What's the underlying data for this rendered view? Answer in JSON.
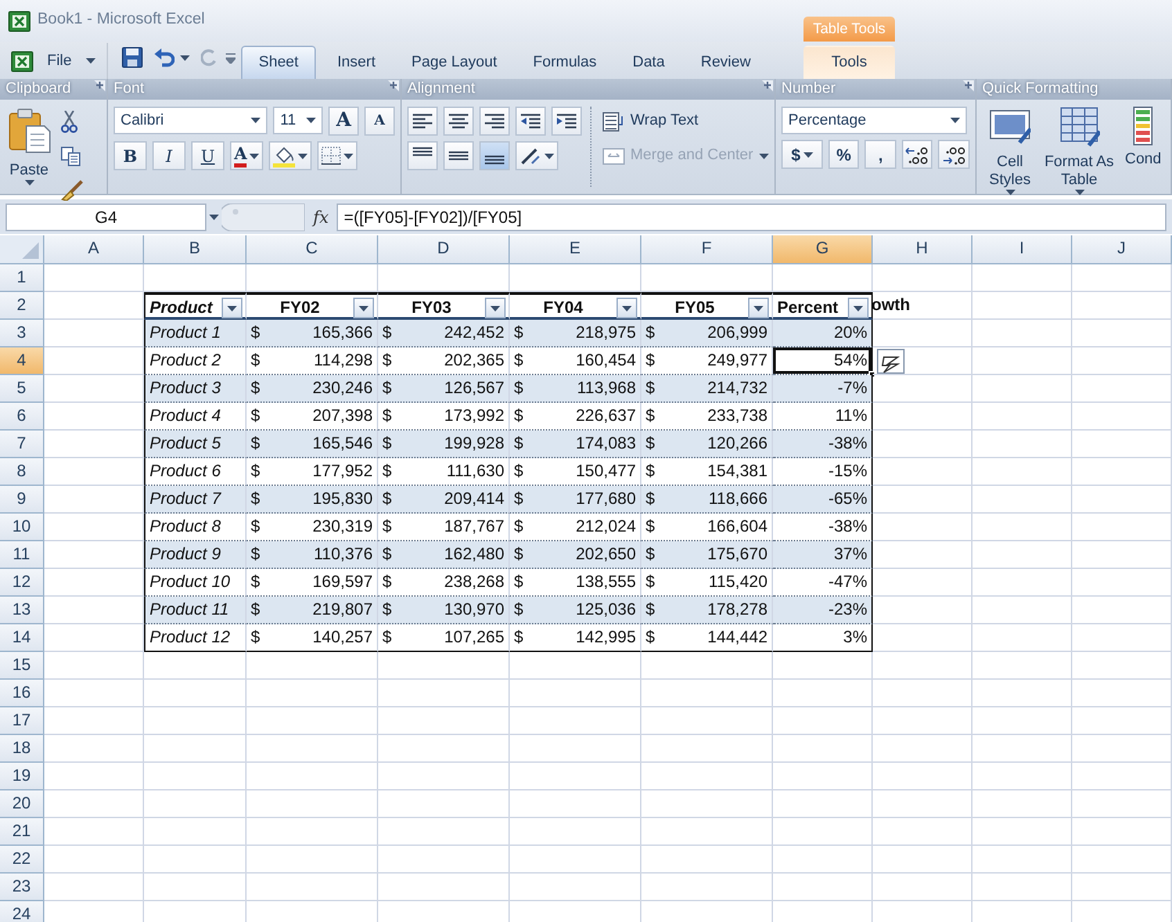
{
  "window": {
    "title": "Book1 - Microsoft Excel"
  },
  "ribbon": {
    "file_menu": "File",
    "tabs": [
      {
        "label": "Sheet",
        "selected": true
      },
      {
        "label": "Insert",
        "selected": false
      },
      {
        "label": "Page Layout",
        "selected": false
      },
      {
        "label": "Formulas",
        "selected": false
      },
      {
        "label": "Data",
        "selected": false
      },
      {
        "label": "Review",
        "selected": false
      },
      {
        "label": "Tools",
        "selected": false,
        "context": "Table Tools"
      }
    ],
    "clipboard": {
      "title": "Clipboard",
      "paste": "Paste"
    },
    "font": {
      "title": "Font",
      "family": "Calibri",
      "size": "11",
      "grow": "A",
      "shrink": "A",
      "styles": [
        {
          "kind": "bold",
          "label": "B"
        },
        {
          "kind": "italic",
          "label": "I"
        },
        {
          "kind": "underline",
          "label": "U"
        }
      ],
      "font_color": "A"
    },
    "alignment": {
      "title": "Alignment",
      "wrap_text": {
        "label": "Wrap Text",
        "disabled": false
      },
      "merge": {
        "label": "Merge and Center",
        "disabled": true
      },
      "vertical_align": [
        {
          "kind": "top",
          "selected": false
        },
        {
          "kind": "middle",
          "selected": false
        },
        {
          "kind": "bottom",
          "selected": true
        }
      ]
    },
    "number": {
      "title": "Number",
      "format": "Percentage",
      "symbols": [
        {
          "kind": "currency",
          "label": "$"
        },
        {
          "kind": "percent",
          "label": "%"
        },
        {
          "kind": "comma",
          "label": ","
        }
      ]
    },
    "quick_formatting": {
      "title": "Quick Formatting",
      "items": [
        {
          "kind": "cell-styles",
          "label": "Cell Styles"
        },
        {
          "kind": "format-table",
          "label": "Format As Table"
        },
        {
          "kind": "conditional",
          "label": "Cond"
        }
      ]
    }
  },
  "formula_bar": {
    "name_box": "G4",
    "fx": "fx",
    "formula": "=([FY05]-[FY02])/[FY05]"
  },
  "sheet": {
    "columns": [
      {
        "label": "A",
        "selected": false
      },
      {
        "label": "B",
        "selected": false
      },
      {
        "label": "C",
        "selected": false
      },
      {
        "label": "D",
        "selected": false
      },
      {
        "label": "E",
        "selected": false
      },
      {
        "label": "F",
        "selected": false
      },
      {
        "label": "G",
        "selected": true
      },
      {
        "label": "H",
        "selected": false
      },
      {
        "label": "I",
        "selected": false
      },
      {
        "label": "J",
        "selected": false
      }
    ],
    "rows": [
      {
        "label": "1",
        "selected": false
      },
      {
        "label": "2",
        "selected": false
      },
      {
        "label": "3",
        "selected": false
      },
      {
        "label": "4",
        "selected": true
      },
      {
        "label": "5",
        "selected": false
      },
      {
        "label": "6",
        "selected": false
      },
      {
        "label": "7",
        "selected": false
      },
      {
        "label": "8",
        "selected": false
      },
      {
        "label": "9",
        "selected": false
      },
      {
        "label": "10",
        "selected": false
      },
      {
        "label": "11",
        "selected": false
      },
      {
        "label": "12",
        "selected": false
      },
      {
        "label": "13",
        "selected": false
      },
      {
        "label": "14",
        "selected": false
      },
      {
        "label": "15",
        "selected": false
      },
      {
        "label": "16",
        "selected": false
      },
      {
        "label": "17",
        "selected": false
      },
      {
        "label": "18",
        "selected": false
      },
      {
        "label": "19",
        "selected": false
      },
      {
        "label": "20",
        "selected": false
      },
      {
        "label": "21",
        "selected": false
      },
      {
        "label": "22",
        "selected": false
      },
      {
        "label": "23",
        "selected": false
      },
      {
        "label": "24",
        "selected": false
      }
    ],
    "table": {
      "banded": true,
      "header": [
        {
          "label": "Product",
          "filter": true
        },
        {
          "label": "FY02",
          "filter": true
        },
        {
          "label": "FY03",
          "filter": true
        },
        {
          "label": "FY04",
          "filter": true
        },
        {
          "label": "FY05",
          "filter": true
        },
        {
          "label": "Percent",
          "filter": true
        }
      ],
      "header_overflow": "owth",
      "rows": [
        {
          "product": "Product 1",
          "amounts": [
            [
              "$",
              "165,366"
            ],
            [
              "$",
              "242,452"
            ],
            [
              "$",
              "218,975"
            ],
            [
              "$",
              "206,999"
            ]
          ],
          "growth": "20%",
          "selected": false
        },
        {
          "product": "Product 2",
          "amounts": [
            [
              "$",
              "114,298"
            ],
            [
              "$",
              "202,365"
            ],
            [
              "$",
              "160,454"
            ],
            [
              "$",
              "249,977"
            ]
          ],
          "growth": "54%",
          "selected": true
        },
        {
          "product": "Product 3",
          "amounts": [
            [
              "$",
              "230,246"
            ],
            [
              "$",
              "126,567"
            ],
            [
              "$",
              "113,968"
            ],
            [
              "$",
              "214,732"
            ]
          ],
          "growth": "-7%",
          "selected": false
        },
        {
          "product": "Product 4",
          "amounts": [
            [
              "$",
              "207,398"
            ],
            [
              "$",
              "173,992"
            ],
            [
              "$",
              "226,637"
            ],
            [
              "$",
              "233,738"
            ]
          ],
          "growth": "11%",
          "selected": false
        },
        {
          "product": "Product 5",
          "amounts": [
            [
              "$",
              "165,546"
            ],
            [
              "$",
              "199,928"
            ],
            [
              "$",
              "174,083"
            ],
            [
              "$",
              "120,266"
            ]
          ],
          "growth": "-38%",
          "selected": false
        },
        {
          "product": "Product 6",
          "amounts": [
            [
              "$",
              "177,952"
            ],
            [
              "$",
              "111,630"
            ],
            [
              "$",
              "150,477"
            ],
            [
              "$",
              "154,381"
            ]
          ],
          "growth": "-15%",
          "selected": false
        },
        {
          "product": "Product 7",
          "amounts": [
            [
              "$",
              "195,830"
            ],
            [
              "$",
              "209,414"
            ],
            [
              "$",
              "177,680"
            ],
            [
              "$",
              "118,666"
            ]
          ],
          "growth": "-65%",
          "selected": false
        },
        {
          "product": "Product 8",
          "amounts": [
            [
              "$",
              "230,319"
            ],
            [
              "$",
              "187,767"
            ],
            [
              "$",
              "212,024"
            ],
            [
              "$",
              "166,604"
            ]
          ],
          "growth": "-38%",
          "selected": false
        },
        {
          "product": "Product 9",
          "amounts": [
            [
              "$",
              "110,376"
            ],
            [
              "$",
              "162,480"
            ],
            [
              "$",
              "202,650"
            ],
            [
              "$",
              "175,670"
            ]
          ],
          "growth": "37%",
          "selected": false
        },
        {
          "product": "Product 10",
          "amounts": [
            [
              "$",
              "169,597"
            ],
            [
              "$",
              "238,268"
            ],
            [
              "$",
              "138,555"
            ],
            [
              "$",
              "115,420"
            ]
          ],
          "growth": "-47%",
          "selected": false
        },
        {
          "product": "Product 11",
          "amounts": [
            [
              "$",
              "219,807"
            ],
            [
              "$",
              "130,970"
            ],
            [
              "$",
              "125,036"
            ],
            [
              "$",
              "178,278"
            ]
          ],
          "growth": "-23%",
          "selected": false
        },
        {
          "product": "Product 12",
          "amounts": [
            [
              "$",
              "140,257"
            ],
            [
              "$",
              "107,265"
            ],
            [
              "$",
              "142,995"
            ],
            [
              "$",
              "144,442"
            ]
          ],
          "growth": "3%",
          "selected": false
        }
      ]
    }
  }
}
